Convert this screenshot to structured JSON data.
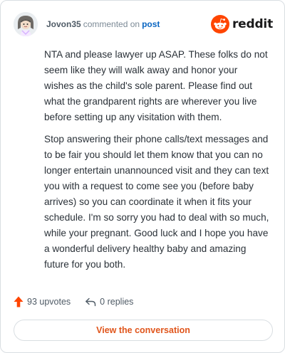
{
  "comment": {
    "author": "Jovon35",
    "action": "commented on",
    "target": "post",
    "paragraphs": [
      "NTA and please lawyer up ASAP. These folks do not seem like they will walk away and honor your wishes as the child's sole parent. Please find out what the grandparent rights are wherever you live before setting up any visitation with them.",
      "Stop answering their phone calls/text messages and to be fair you should let them know that you can no longer entertain unannounced visit and they can text you with a request to come see you (before baby arrives) so you can coordinate it when it fits your schedule. I'm so sorry you had to deal with so much, while your pregnant. Good luck and I hope you have a wonderful delivery healthy baby and amazing future for you both."
    ]
  },
  "brand": {
    "name": "reddit",
    "icon": "reddit-snoo-icon",
    "color": "#ff4500"
  },
  "stats": {
    "upvotes_label": "93 upvotes",
    "replies_label": "0 replies",
    "upvote_icon": "upvote-arrow-icon",
    "reply_icon": "reply-arrow-icon",
    "upvote_color": "#ff4500"
  },
  "cta": {
    "label": "View the conversation",
    "color": "#e0551b"
  },
  "avatar_icon": "user-avatar-icon"
}
